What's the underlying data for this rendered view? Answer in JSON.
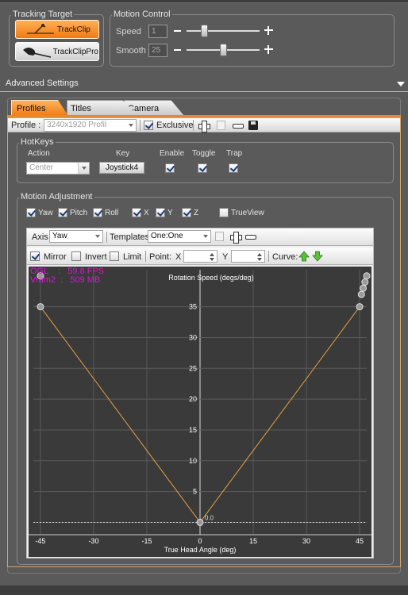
{
  "tracking_target": {
    "legend": "Tracking Target",
    "buttons": [
      {
        "label": "TrackClip",
        "selected": true
      },
      {
        "label": "TrackClipPro",
        "selected": false
      }
    ]
  },
  "motion_control": {
    "legend": "Motion Control",
    "speed": {
      "label": "Speed",
      "value": "1",
      "level": 0.22
    },
    "smooth": {
      "label": "Smooth",
      "value": "25",
      "level": 0.5
    }
  },
  "advanced_settings": {
    "title": "Advanced Settings"
  },
  "tabs": [
    {
      "label": "Profiles",
      "active": true
    },
    {
      "label": "Titles",
      "active": false
    },
    {
      "label": "Camera",
      "active": false
    }
  ],
  "profile_toolbar": {
    "profile_label": "Profile :",
    "profile_value": "3240x1920 Profil",
    "exclusive_label": "Exclusive",
    "exclusive_checked": true
  },
  "hotkeys": {
    "legend": "HotKeys",
    "headers": {
      "action": "Action",
      "key": "Key",
      "enable": "Enable",
      "toggle": "Toggle",
      "trap": "Trap"
    },
    "action_value": "Center",
    "key_value": "Joystick4",
    "enable": true,
    "toggle": true,
    "trap": true
  },
  "motion_adjustment": {
    "legend": "Motion Adjustment",
    "axes": [
      {
        "label": "Yaw",
        "checked": true
      },
      {
        "label": "Pitch",
        "checked": true
      },
      {
        "label": "Roll",
        "checked": true
      },
      {
        "label": "X",
        "checked": true
      },
      {
        "label": "Y",
        "checked": true
      },
      {
        "label": "Z",
        "checked": true
      },
      {
        "label": "TrueView",
        "checked": false
      }
    ]
  },
  "graph_toolbar": {
    "axis_label": "Axis",
    "axis_value": "Yaw",
    "templates_label": "Templates",
    "templates_value": "One:One",
    "mirror_label": "Mirror",
    "mirror": true,
    "invert_label": "Invert",
    "invert": false,
    "limit_label": "Limit",
    "limit": false,
    "point_label": "Point:",
    "x_label": "X",
    "y_label": "Y",
    "curve_label": "Curve:"
  },
  "overlay": {
    "line1": "OGL    :   59.8 FPS",
    "line2": "Vram2  :   509 MB",
    "color": "#d21ad2"
  },
  "chart_data": {
    "type": "line",
    "xlabel": "True Head Angle (deg)",
    "ylabel": "Rotation Speed (degs/deg)",
    "xlim": [
      -47,
      47
    ],
    "ylim": [
      -2,
      41
    ],
    "xticks": [
      -45,
      -30,
      -15,
      0,
      15,
      30,
      45
    ],
    "yticks": [
      0,
      5,
      10,
      15,
      20,
      25,
      30,
      35
    ],
    "ytick_labels": [
      "0",
      "5",
      "10",
      "15",
      "20",
      "25",
      "30",
      "35"
    ],
    "xtick_labels": [
      "-45",
      "-30",
      "-15",
      "0",
      "15",
      "30",
      "45"
    ],
    "origin_label": "0.0",
    "line_color": "#e8a040",
    "series": [
      {
        "x": [
          -45,
          0,
          45
        ],
        "y": [
          35,
          0,
          35
        ]
      }
    ],
    "control_points": {
      "x": [
        -45,
        -45,
        0,
        45,
        45.5,
        46,
        46.5,
        47
      ],
      "y": [
        35,
        40,
        0,
        35,
        37,
        38,
        39,
        40
      ]
    }
  }
}
